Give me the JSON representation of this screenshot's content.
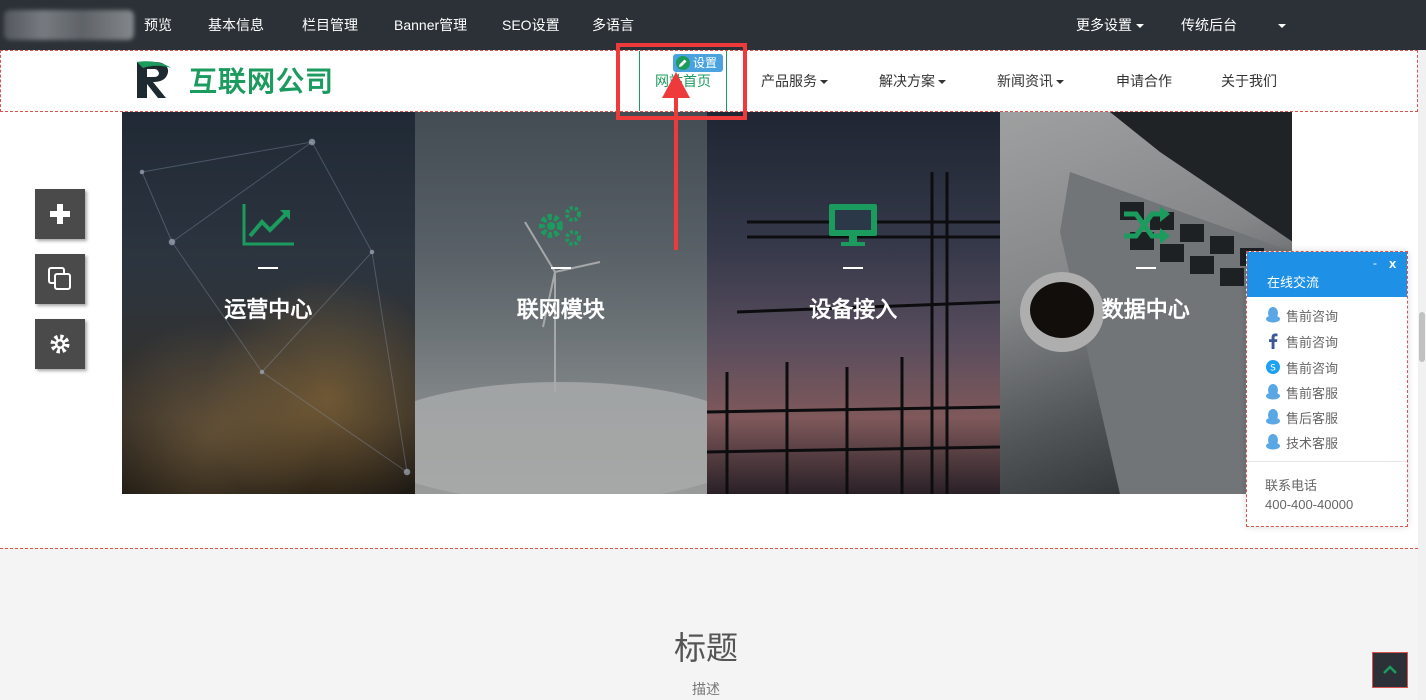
{
  "admin_bar": {
    "items": [
      {
        "label": "预览"
      },
      {
        "label": "基本信息"
      },
      {
        "label": "栏目管理"
      },
      {
        "label": "Banner管理"
      },
      {
        "label": "SEO设置"
      },
      {
        "label": "多语言"
      }
    ],
    "more_settings": "更多设置",
    "classic_backend": "传统后台"
  },
  "header": {
    "logo_text": "互联网公司",
    "settings_tag": "设置",
    "nav": [
      {
        "label": "网站首页",
        "active": true
      },
      {
        "label": "产品服务",
        "dropdown": true
      },
      {
        "label": "解决方案",
        "dropdown": true
      },
      {
        "label": "新闻资讯",
        "dropdown": true
      },
      {
        "label": "申请合作"
      },
      {
        "label": "关于我们"
      }
    ]
  },
  "tiles": [
    {
      "title": "运营中心",
      "icon": "line-chart-icon"
    },
    {
      "title": "联网模块",
      "icon": "gears-icon"
    },
    {
      "title": "设备接入",
      "icon": "monitor-icon"
    },
    {
      "title": "数据中心",
      "icon": "shuffle-icon"
    }
  ],
  "left_tools": [
    "plus-icon",
    "copy-icon",
    "gear-icon"
  ],
  "section2": {
    "title": "标题",
    "description": "描述"
  },
  "chat": {
    "title": "在线交流",
    "minimize": "-",
    "close": "x",
    "items": [
      {
        "label": "售前咨询",
        "icon": "qq-icon"
      },
      {
        "label": "售前咨询",
        "icon": "facebook-icon"
      },
      {
        "label": "售前咨询",
        "icon": "skype-icon"
      },
      {
        "label": "售前客服",
        "icon": "qq-icon"
      },
      {
        "label": "售后客服",
        "icon": "qq-icon"
      },
      {
        "label": "技术客服",
        "icon": "qq-icon"
      }
    ],
    "phone_label": "联系电话",
    "phone_number": "400-400-40000"
  },
  "colors": {
    "brand_green": "#1c9b5e",
    "admin_bar": "#2b3137",
    "chat_blue": "#1e90e6",
    "annotation_red": "#ee3a3a"
  }
}
